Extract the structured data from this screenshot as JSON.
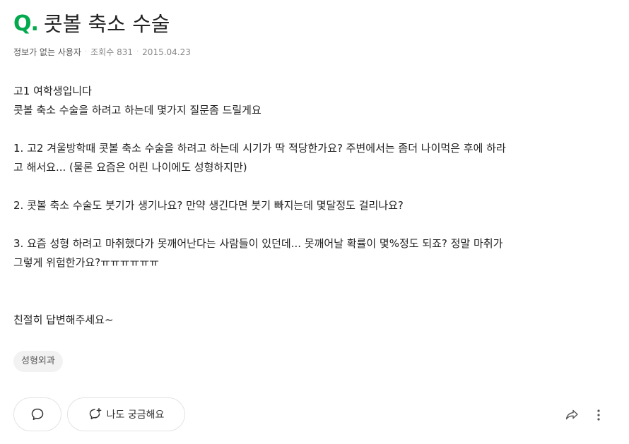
{
  "question": {
    "marker": "Q.",
    "title": "콧볼 축소 수술"
  },
  "meta": {
    "author": "정보가 없는 사용자",
    "views_label": "조회수 831",
    "date": "2015.04.23"
  },
  "body": {
    "lines": [
      "고1 여학생입니다",
      "콧볼 축소 수술을 하려고 하는데 몇가지 질문좀 드릴게요",
      "",
      "1. 고2 겨울방학때 콧볼 축소 수술을 하려고 하는데 시기가 딱 적당한가요? 주변에서는 좀더 나이먹은 후에 하라",
      "고 해서요... (물론 요즘은 어린 나이에도 성형하지만)",
      "",
      "2. 콧볼 축소 수술도 붓기가 생기나요? 만약 생긴다면 붓기 빠지는데 몇달정도 걸리나요?",
      "",
      "3. 요즘 성형 하려고 마취했다가 못깨어난다는 사람들이 있던데... 못깨어날 확률이 몇%정도 되죠? 정말 마취가",
      "그렇게 위험한가요?ㅠㅠㅠㅠㅠㅠ",
      "",
      "",
      "친절히 답변해주세요~"
    ]
  },
  "tags": [
    "성형외과"
  ],
  "actions": {
    "comment_icon": "speech-bubble-icon",
    "curious_label": "나도 궁금해요",
    "curious_icon": "question-bubble-plus-icon",
    "share_icon": "share-arrow-icon",
    "more_icon": "vertical-dots-icon"
  },
  "colors": {
    "accent": "#03a94d",
    "text": "#222222",
    "meta": "#555555",
    "border": "#e3e3e3",
    "tag_bg": "#f2f2f2"
  }
}
